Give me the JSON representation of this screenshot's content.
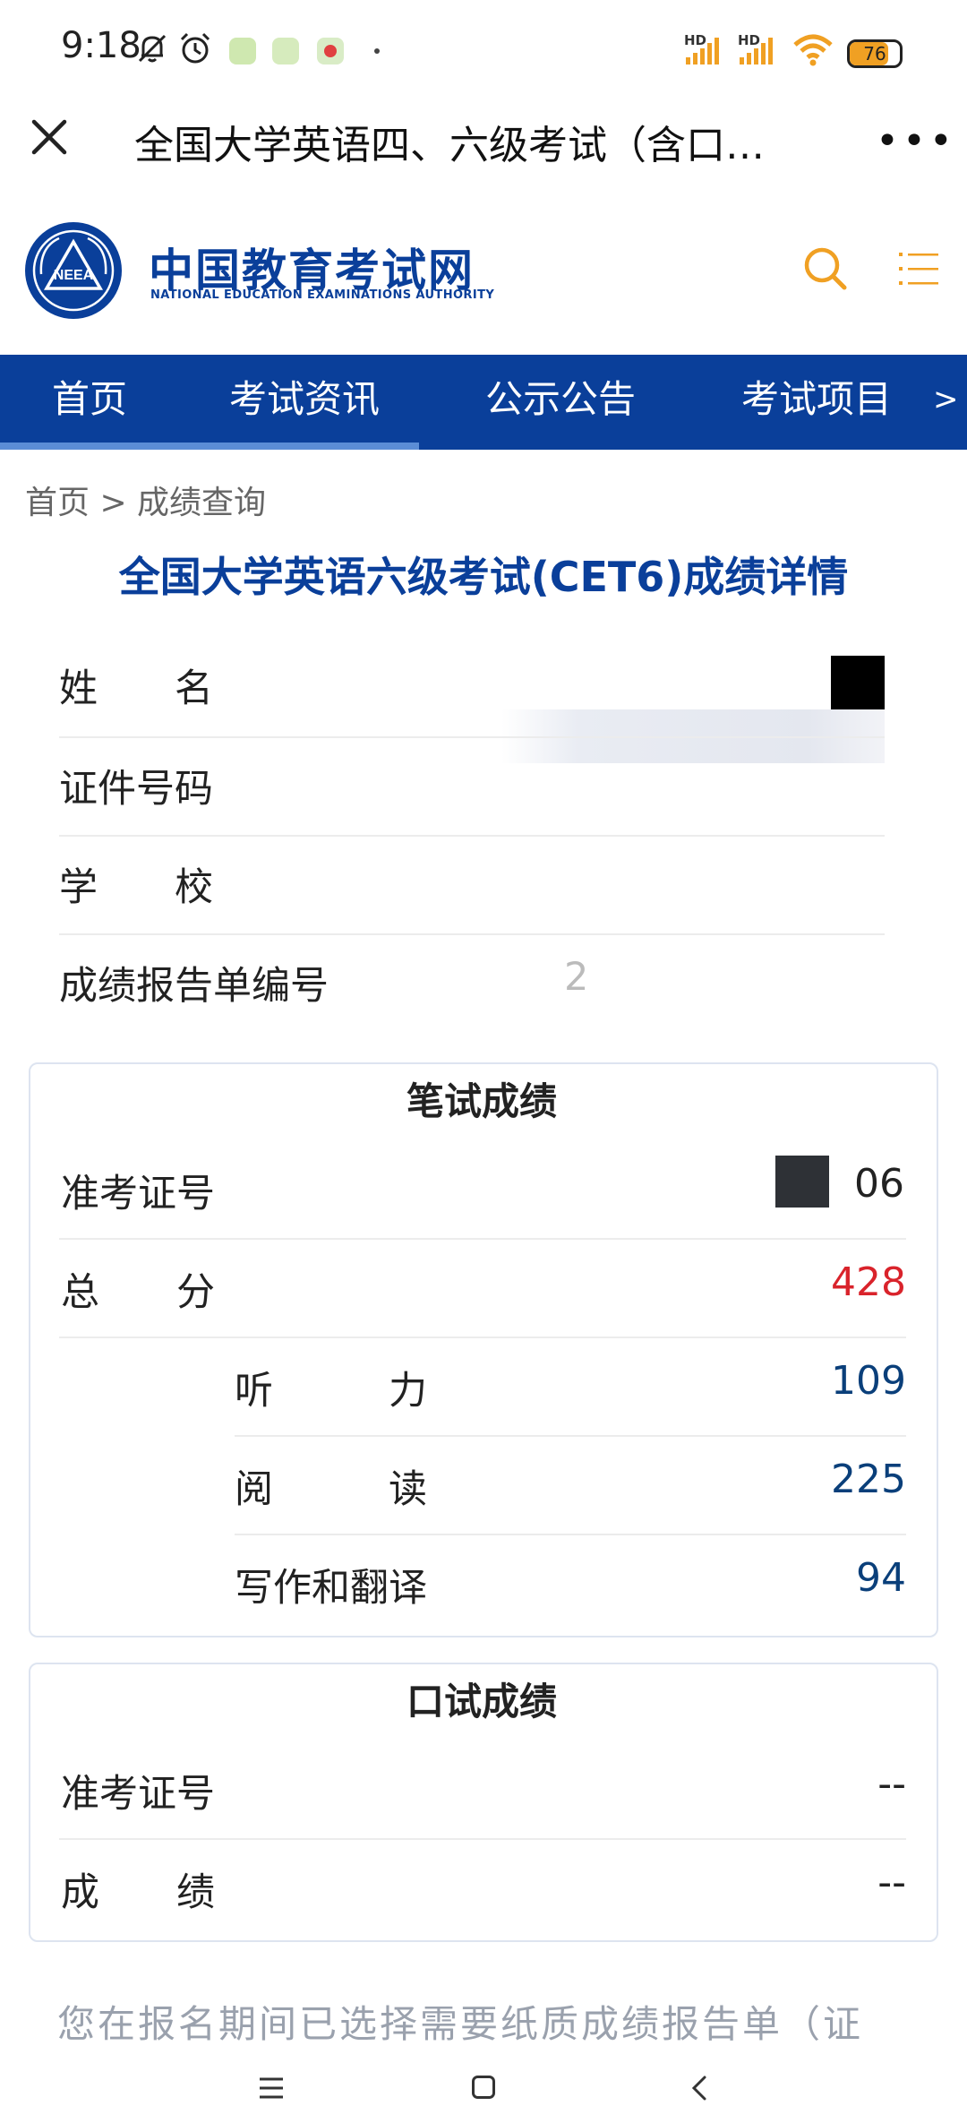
{
  "status_bar": {
    "time": "9:18",
    "battery": "76",
    "battery_level": 0.76,
    "signal_labels": [
      "HD",
      "HD"
    ],
    "icons": [
      "bell-off-icon",
      "alarm-icon",
      "app-icon",
      "app-icon",
      "app-icon",
      "signal-icon",
      "signal-icon",
      "wifi-icon",
      "battery-icon"
    ]
  },
  "app_bar": {
    "title": "全国大学英语四、六级考试（含口…",
    "more": "•••"
  },
  "site": {
    "logo_cn": "中国教育考试网",
    "logo_en": "NATIONAL EDUCATION EXAMINATIONS AUTHORITY",
    "emblem_text": "NEEA"
  },
  "nav": {
    "items": [
      "首页",
      "考试资讯",
      "公示公告",
      "考试项目"
    ],
    "arrow": ">"
  },
  "breadcrumb": "首页 > 成绩查询",
  "page_title": "全国大学英语六级考试(CET6)成绩详情",
  "personal_info": [
    {
      "label": "姓　　名"
    },
    {
      "label": "证件号码"
    },
    {
      "label": "学　　校"
    },
    {
      "label": "成绩报告单编号",
      "value_fragment": "2"
    }
  ],
  "written": {
    "title": "笔试成绩",
    "admission_label": "准考证号",
    "admission_value_fragment": "06",
    "total_label": "总　　分",
    "total_value": "428",
    "sub_scores": [
      {
        "label": "听　　　力",
        "value": "109"
      },
      {
        "label": "阅　　　读",
        "value": "225"
      },
      {
        "label": "写作和翻译",
        "value": "94"
      }
    ]
  },
  "oral": {
    "title": "口试成绩",
    "rows": [
      {
        "label": "准考证号",
        "value": "--"
      },
      {
        "label": "成　　绩",
        "value": "--"
      }
    ]
  },
  "notice": "您在报名期间已选择需要纸质成绩报告单（证",
  "colors": {
    "brand_blue": "#0a3f9a",
    "accent_orange": "#f0a023",
    "total_red": "#d9232b"
  }
}
